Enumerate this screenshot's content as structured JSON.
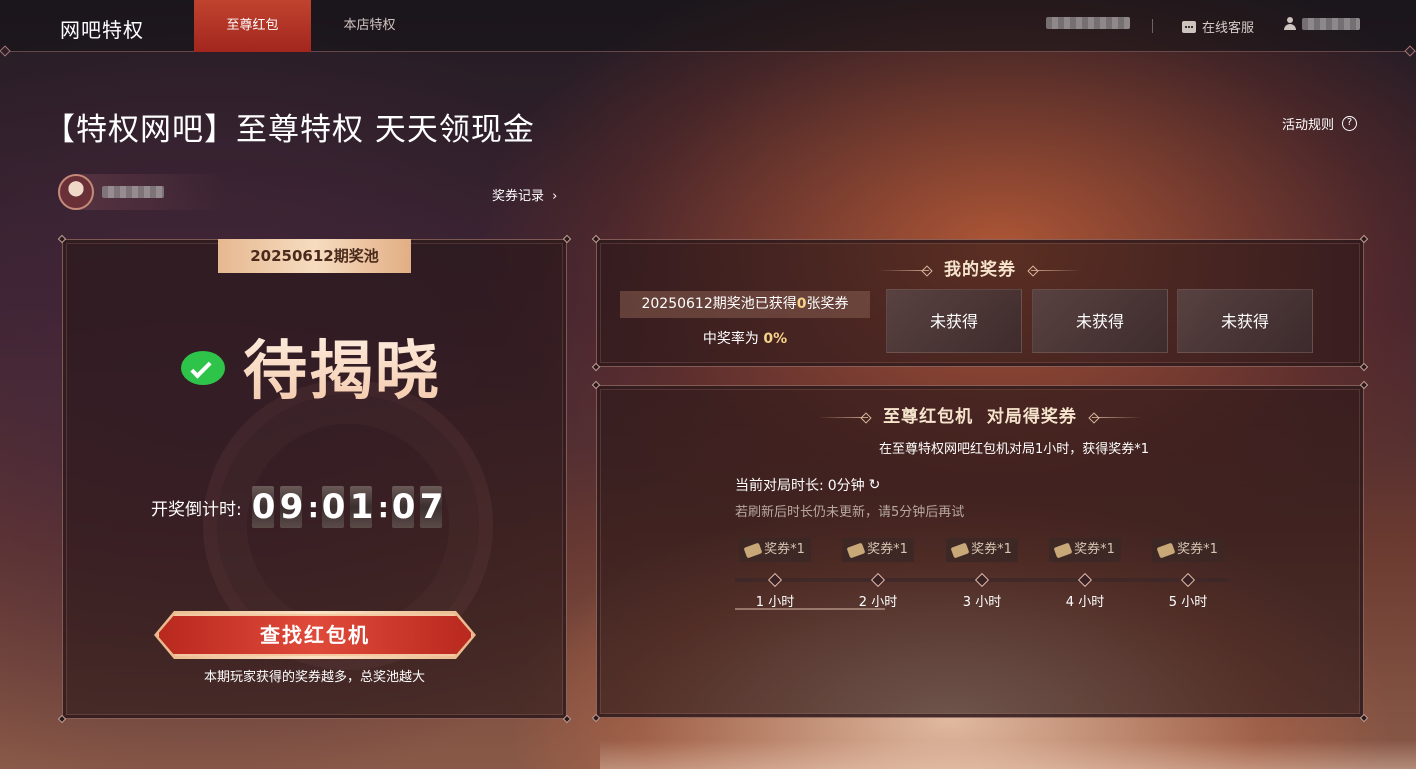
{
  "nav": {
    "brand": "网吧特权",
    "tabs": [
      {
        "label": "至尊红包",
        "active": true
      },
      {
        "label": "本店特权",
        "active": false
      }
    ],
    "customer_service": "在线客服"
  },
  "page": {
    "title": "【特权网吧】至尊特权 天天领现金",
    "rules_link": "活动规则",
    "voucher_record": "奖券记录"
  },
  "pool": {
    "period_tab": "20250612期奖池",
    "status": "待揭晓",
    "countdown_label": "开奖倒计时:",
    "countdown_digits": [
      "0",
      "9",
      "0",
      "1",
      "0",
      "7"
    ],
    "find_button": "查找红包机",
    "hint": "本期玩家获得的奖券越多，总奖池越大"
  },
  "my_vouchers": {
    "title": "我的奖券",
    "summary_prefix": "20250612期奖池已获得",
    "summary_count": "0",
    "summary_suffix": "张奖券",
    "win_rate_prefix": "中奖率为",
    "win_rate_value": "0%",
    "cards": [
      "未获得",
      "未获得",
      "未获得"
    ]
  },
  "mission": {
    "title": "至尊红包机  对局得奖券",
    "description": "在至尊特权网吧红包机对局1小时，获得奖券*1",
    "current_label": "当前对局时长:",
    "current_value": "0分钟",
    "refresh_hint": "若刷新后时长仍未更新，请5分钟后再试",
    "milestones": [
      {
        "reward": "奖券*1",
        "label": "1 小时"
      },
      {
        "reward": "奖券*1",
        "label": "2 小时"
      },
      {
        "reward": "奖券*1",
        "label": "3 小时"
      },
      {
        "reward": "奖券*1",
        "label": "4 小时"
      },
      {
        "reward": "奖券*1",
        "label": "5 小时"
      }
    ]
  },
  "colors": {
    "accent_red": "#b8281e",
    "gold": "#f6d28a",
    "wechat_green": "#2ec44a"
  },
  "icons": [
    "question-icon",
    "chat-icon",
    "user-icon",
    "wechat-icon",
    "refresh-icon",
    "ticket-icon",
    "chevron-right-icon"
  ]
}
